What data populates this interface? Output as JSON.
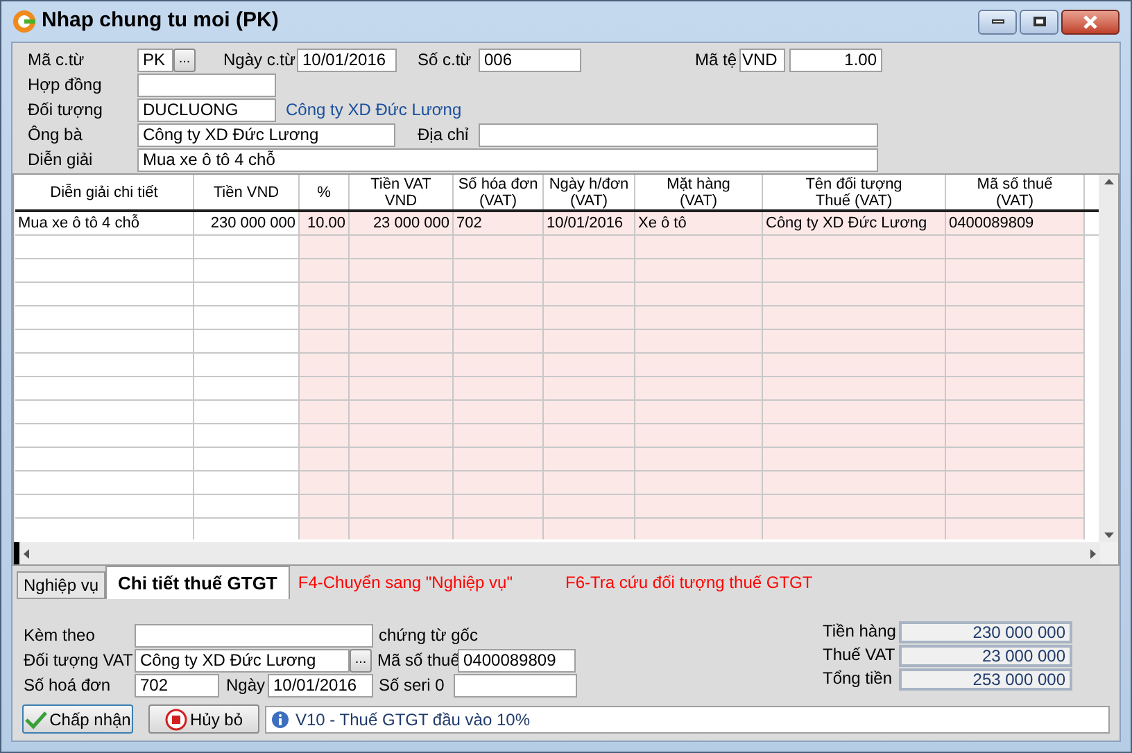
{
  "window": {
    "title": "Nhap chung tu moi (PK)"
  },
  "header": {
    "voucher_type": {
      "label": "Mã c.từ",
      "value": "PK",
      "button": "..."
    },
    "date": {
      "label": "Ngày c.từ",
      "value": "10/01/2016"
    },
    "number": {
      "label": "Số c.từ",
      "value": "006"
    },
    "currency": {
      "label": "Mã tệ",
      "code": "VND",
      "rate": "1.00"
    },
    "contract": {
      "label": "Hợp đồng"
    },
    "partner": {
      "label": "Đối tượng",
      "value": "DUCLUONG",
      "name": "Công ty XD Đức Lương"
    },
    "person": {
      "label": "Ông bà",
      "value": "Công ty XD Đức Lương"
    },
    "address": {
      "label": "Địa chỉ"
    },
    "description": {
      "label": "Diễn giải",
      "value": "Mua xe ô tô 4 chỗ"
    }
  },
  "table": {
    "columns": [
      {
        "lines": [
          "Diễn giải chi tiết"
        ],
        "tinted": false,
        "kind": "text"
      },
      {
        "lines": [
          "Tiền VND"
        ],
        "tinted": false,
        "kind": "amount"
      },
      {
        "lines": [
          "%"
        ],
        "tinted": true,
        "kind": "amount"
      },
      {
        "lines": [
          "Tiền VAT",
          "VND"
        ],
        "tinted": true,
        "kind": "amount"
      },
      {
        "lines": [
          "Số hóa đơn",
          "(VAT)"
        ],
        "tinted": true,
        "kind": "text"
      },
      {
        "lines": [
          "Ngày h/đơn",
          "(VAT)"
        ],
        "tinted": true,
        "kind": "text"
      },
      {
        "lines": [
          "Mặt hàng",
          "(VAT)"
        ],
        "tinted": true,
        "kind": "text"
      },
      {
        "lines": [
          "Tên đối tượng",
          "Thuế (VAT)"
        ],
        "tinted": true,
        "kind": "text"
      },
      {
        "lines": [
          "Mã số thuế",
          "(VAT)"
        ],
        "tinted": true,
        "kind": "text"
      }
    ],
    "rows": [
      {
        "cells": [
          "Mua xe ô tô 4 chỗ",
          "230 000 000",
          "10.00",
          "23 000 000",
          "702",
          "10/01/2016",
          "Xe ô tô",
          "Công ty XD Đức Lương",
          "0400089809"
        ]
      }
    ]
  },
  "tabs": [
    {
      "label": "Nghiệp vụ",
      "selected": false
    },
    {
      "label": "Chi tiết thuế GTGT",
      "selected": true
    }
  ],
  "hints": [
    "F4-Chuyển sang \"Nghiệp vụ\"",
    "F6-Tra cứu đối tượng thuế GTGT"
  ],
  "vat": {
    "attachments": {
      "label": "Kèm theo",
      "suffix": "chứng từ gốc"
    },
    "partner": {
      "label": "Đối tượng VAT",
      "value": "Công ty XD Đức Lương",
      "button": "..."
    },
    "tax_code": {
      "label": "Mã số thuế",
      "value": "0400089809"
    },
    "invoice": {
      "label": "Số hoá đơn",
      "value": "702"
    },
    "invoice_date": {
      "label": "Ngày",
      "value": "10/01/2016"
    },
    "serial": {
      "label": "Số seri 0"
    }
  },
  "totals": [
    {
      "label": "Tiền hàng",
      "value": "230 000 000"
    },
    {
      "label": "Thuế VAT",
      "value": "23 000 000"
    },
    {
      "label": "Tổng tiền",
      "value": "253 000 000"
    }
  ],
  "buttons": [
    {
      "label": "Chấp nhận",
      "kind": "accept"
    },
    {
      "label": "Hủy bỏ",
      "kind": "cancel"
    }
  ],
  "status": "V10 - Thuế GTGT đầu vào 10%"
}
